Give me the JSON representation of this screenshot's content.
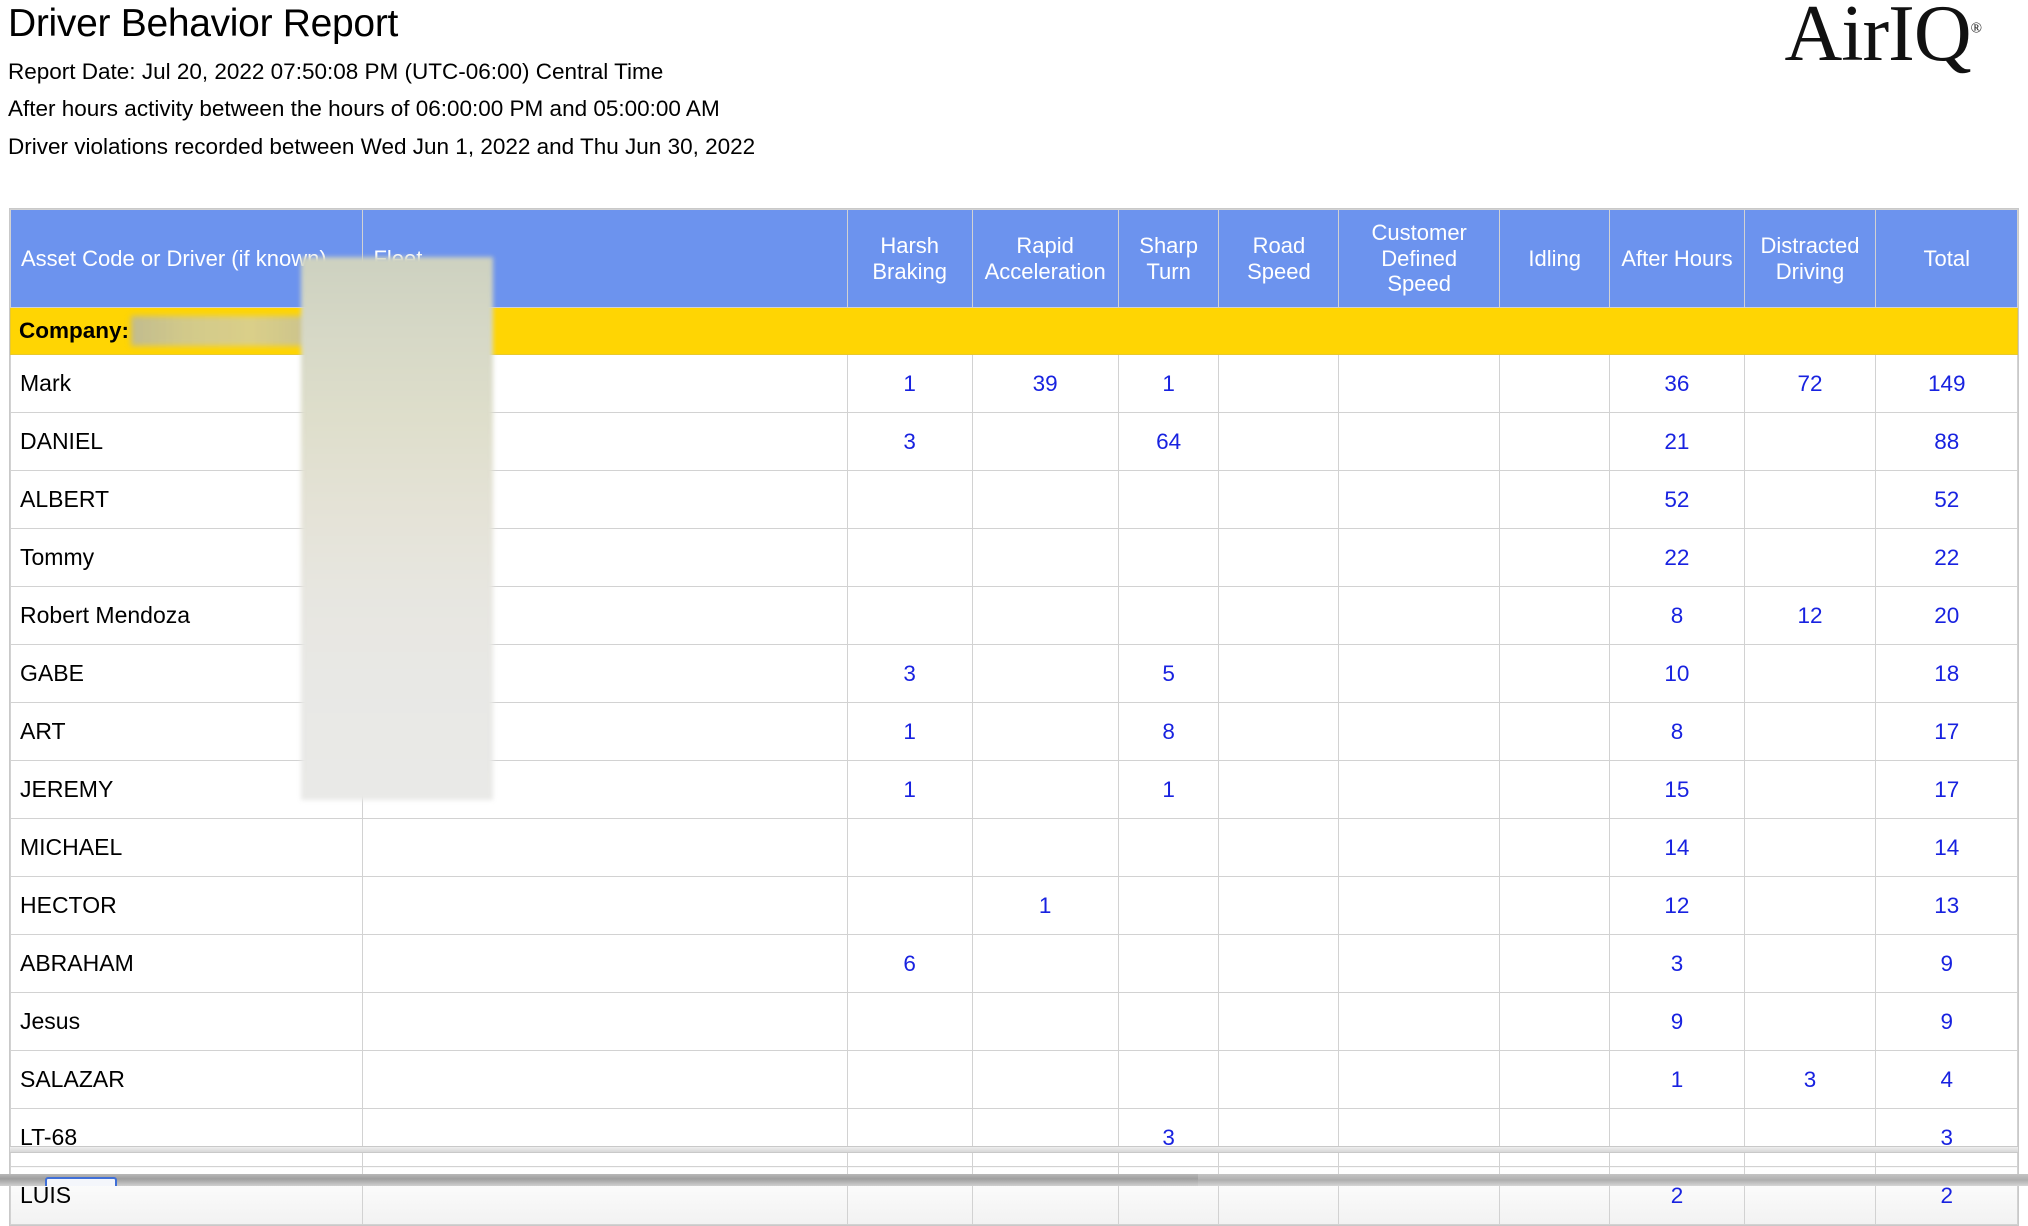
{
  "header": {
    "title": "Driver Behavior Report",
    "report_date_line": "Report Date: Jul 20, 2022 07:50:08 PM (UTC-06:00) Central Time",
    "after_hours_line": "After hours activity between the hours of 06:00:00 PM and 05:00:00 AM",
    "violations_line": "Driver violations recorded between Wed Jun 1, 2022 and Thu Jun 30, 2022",
    "logo_text": "AirIQ",
    "logo_trademark": "®"
  },
  "colors": {
    "header_blue": "#6c93ee",
    "company_yellow": "#ffd503",
    "value_blue": "#1822e0",
    "grid_gray": "#d2d2d2"
  },
  "table": {
    "columns": [
      "Asset Code or Driver (if known)",
      "Fleet",
      "",
      "Harsh Braking",
      "Rapid Acceleration",
      "Sharp Turn",
      "Road Speed",
      "Customer Defined Speed",
      "Idling",
      "After Hours",
      "Distracted Driving",
      "Total"
    ],
    "column_lines": {
      "harsh": [
        "Harsh",
        "Braking"
      ],
      "rapid": [
        "Rapid",
        "Acceleration"
      ],
      "sharp": [
        "Sharp",
        "Turn"
      ],
      "road": [
        "Road",
        "Speed"
      ],
      "customer": [
        "Customer",
        "Defined",
        "Speed"
      ],
      "idling": [
        "Idling"
      ],
      "after_hours": [
        "After Hours"
      ],
      "distracted": [
        "Distracted",
        "Driving"
      ],
      "total": [
        "Total"
      ]
    },
    "group_row": {
      "label": "Company:",
      "value": "",
      "redacted": true
    },
    "rows": [
      {
        "name": "Mark",
        "fleet": "",
        "harsh": "1",
        "rapid": "39",
        "sharp": "1",
        "road": "",
        "customer": "",
        "idling": "",
        "after_hours": "36",
        "distracted": "72",
        "total": "149"
      },
      {
        "name": "DANIEL",
        "fleet": "",
        "harsh": "3",
        "rapid": "",
        "sharp": "64",
        "road": "",
        "customer": "",
        "idling": "",
        "after_hours": "21",
        "distracted": "",
        "total": "88"
      },
      {
        "name": "ALBERT",
        "fleet": "",
        "harsh": "",
        "rapid": "",
        "sharp": "",
        "road": "",
        "customer": "",
        "idling": "",
        "after_hours": "52",
        "distracted": "",
        "total": "52"
      },
      {
        "name": "Tommy",
        "fleet": "",
        "harsh": "",
        "rapid": "",
        "sharp": "",
        "road": "",
        "customer": "",
        "idling": "",
        "after_hours": "22",
        "distracted": "",
        "total": "22"
      },
      {
        "name": "Robert Mendoza",
        "fleet": "",
        "harsh": "",
        "rapid": "",
        "sharp": "",
        "road": "",
        "customer": "",
        "idling": "",
        "after_hours": "8",
        "distracted": "12",
        "total": "20"
      },
      {
        "name": "GABE",
        "fleet": "",
        "harsh": "3",
        "rapid": "",
        "sharp": "5",
        "road": "",
        "customer": "",
        "idling": "",
        "after_hours": "10",
        "distracted": "",
        "total": "18"
      },
      {
        "name": "ART",
        "fleet": "",
        "harsh": "1",
        "rapid": "",
        "sharp": "8",
        "road": "",
        "customer": "",
        "idling": "",
        "after_hours": "8",
        "distracted": "",
        "total": "17"
      },
      {
        "name": "JEREMY",
        "fleet": "",
        "harsh": "1",
        "rapid": "",
        "sharp": "1",
        "road": "",
        "customer": "",
        "idling": "",
        "after_hours": "15",
        "distracted": "",
        "total": "17"
      },
      {
        "name": "MICHAEL",
        "fleet": "",
        "harsh": "",
        "rapid": "",
        "sharp": "",
        "road": "",
        "customer": "",
        "idling": "",
        "after_hours": "14",
        "distracted": "",
        "total": "14"
      },
      {
        "name": "HECTOR",
        "fleet": "",
        "harsh": "",
        "rapid": "1",
        "sharp": "",
        "road": "",
        "customer": "",
        "idling": "",
        "after_hours": "12",
        "distracted": "",
        "total": "13"
      },
      {
        "name": "ABRAHAM",
        "fleet": "",
        "harsh": "6",
        "rapid": "",
        "sharp": "",
        "road": "",
        "customer": "",
        "idling": "",
        "after_hours": "3",
        "distracted": "",
        "total": "9"
      },
      {
        "name": "Jesus",
        "fleet": "",
        "harsh": "",
        "rapid": "",
        "sharp": "",
        "road": "",
        "customer": "",
        "idling": "",
        "after_hours": "9",
        "distracted": "",
        "total": "9"
      },
      {
        "name": "SALAZAR",
        "fleet": "",
        "harsh": "",
        "rapid": "",
        "sharp": "",
        "road": "",
        "customer": "",
        "idling": "",
        "after_hours": "1",
        "distracted": "3",
        "total": "4"
      },
      {
        "name": "LT-68",
        "fleet": "",
        "harsh": "",
        "rapid": "",
        "sharp": "3",
        "road": "",
        "customer": "",
        "idling": "",
        "after_hours": "",
        "distracted": "",
        "total": "3"
      },
      {
        "name": "LUIS",
        "fleet": "",
        "harsh": "",
        "rapid": "",
        "sharp": "",
        "road": "",
        "customer": "",
        "idling": "",
        "after_hours": "2",
        "distracted": "",
        "total": "2"
      }
    ]
  }
}
